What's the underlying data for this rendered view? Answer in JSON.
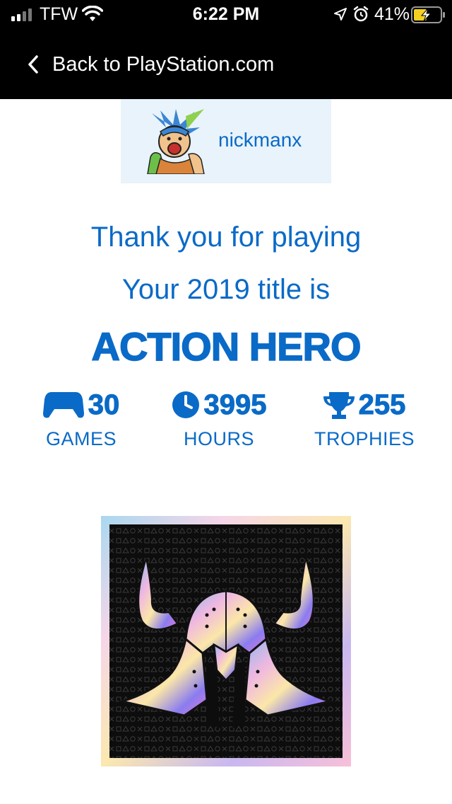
{
  "status_bar": {
    "carrier": "TFW",
    "time": "6:22 PM",
    "battery_percent": "41%",
    "icons": [
      "signal-icon",
      "wifi-icon",
      "location-icon",
      "alarm-icon",
      "battery-charging-icon"
    ]
  },
  "nav": {
    "back_label": "Back to PlayStation.com",
    "back_icon": "chevron-left-icon"
  },
  "user": {
    "username": "nickmanx",
    "avatar_icon": "avatar-image"
  },
  "summary": {
    "thank_you": "Thank you for playing",
    "title_intro": "Your 2019 title is",
    "title": "ACTION HERO"
  },
  "stats": {
    "games": {
      "value": "30",
      "label": "GAMES",
      "icon": "controller-icon"
    },
    "hours": {
      "value": "3995",
      "label": "HOURS",
      "icon": "clock-icon"
    },
    "trophies": {
      "value": "255",
      "label": "TROPHIES",
      "icon": "trophy-icon"
    }
  },
  "badge": {
    "icon": "horned-helmet-badge"
  },
  "colors": {
    "accent": "#0a6ac7",
    "bar_background": "#000000",
    "user_card_background": "#e8f3fb"
  }
}
